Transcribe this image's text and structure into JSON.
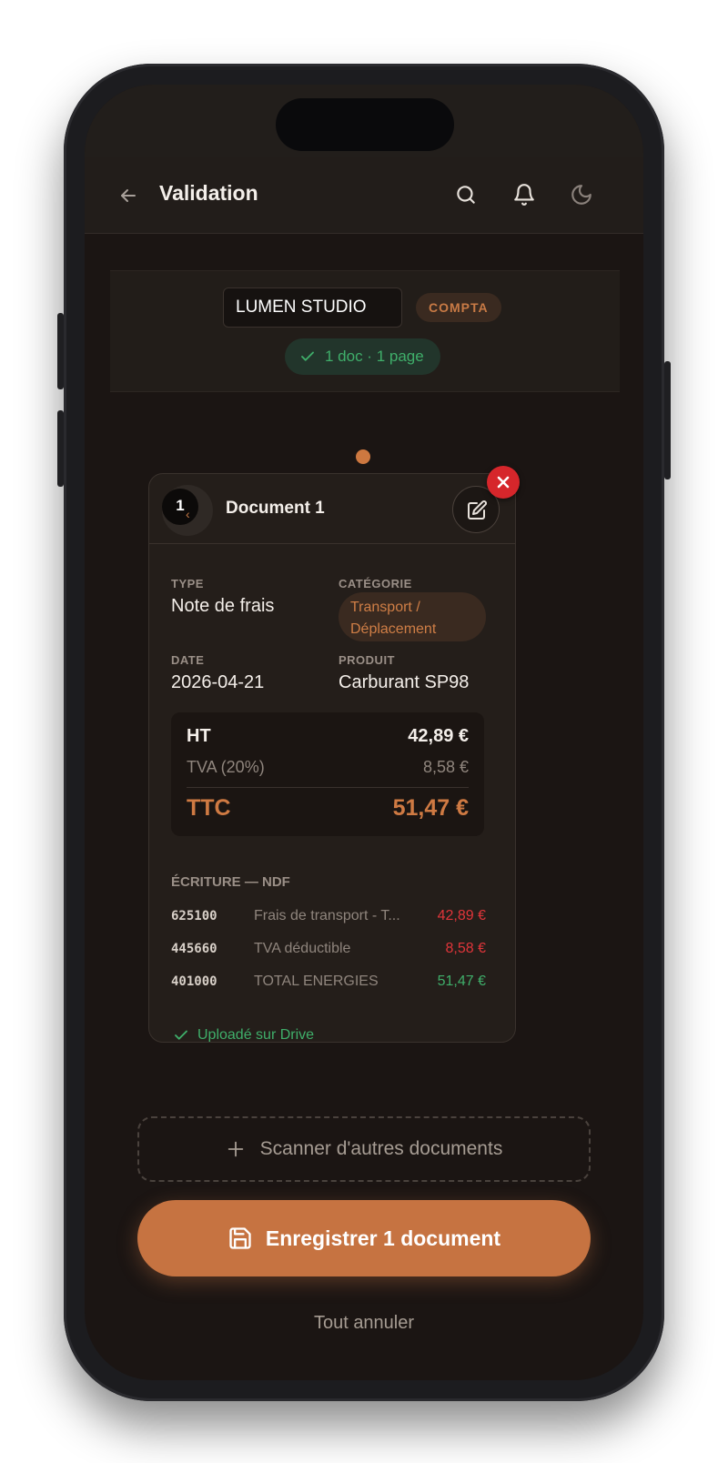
{
  "header": {
    "title": "Validation",
    "icons": [
      "arrow-left-icon",
      "search-icon",
      "bell-icon",
      "moon-icon"
    ]
  },
  "company": {
    "name": "LUMEN STUDIO",
    "tag": "COMPTA",
    "doc_count": "1 doc · 1 page"
  },
  "document": {
    "number": "1",
    "title": "Document 1",
    "type_label": "TYPE",
    "type_value": "Note de frais",
    "category_label": "CATÉGORIE",
    "category_line1": "Transport /",
    "category_line2": "Déplacement",
    "date_label": "DATE",
    "date_value": "2026-04-21",
    "product_label": "PRODUIT",
    "product_value": "Carburant SP98",
    "totals": {
      "ht_label": "HT",
      "ht_value": "42,89 €",
      "tva_label": "TVA (20%)",
      "tva_value": "8,58 €",
      "ttc_label": "TTC",
      "ttc_value": "51,47 €"
    },
    "entries_title": "ÉCRITURE — NDF",
    "entries": [
      {
        "account": "625100",
        "label": "Frais de transport - T...",
        "amount": "42,89 €"
      },
      {
        "account": "445660",
        "label": "TVA déductible",
        "amount": "8,58 €"
      },
      {
        "account": "401000",
        "label": "TOTAL ENERGIES",
        "amount": "51,47 €"
      }
    ],
    "upload_status": "Uploadé sur Drive"
  },
  "actions": {
    "scan_label": "Scanner d'autres documents",
    "save_label": "Enregistrer 1 document",
    "cancel_label": "Tout annuler"
  },
  "colors": {
    "accent": "#c67341",
    "background": "#1b1513",
    "success": "#3fae6a",
    "debit": "#e0353a",
    "close": "#d6262b"
  }
}
